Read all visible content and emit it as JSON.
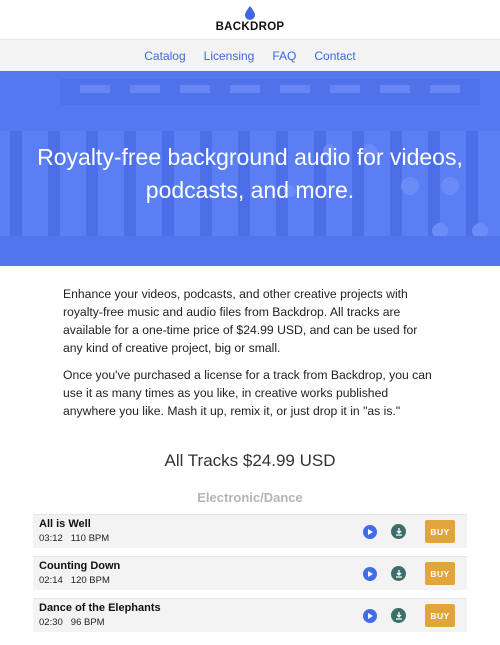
{
  "brand": {
    "logo_text": "BACKDROP"
  },
  "nav": {
    "items": [
      "Catalog",
      "Licensing",
      "FAQ",
      "Contact"
    ]
  },
  "hero": {
    "title": "Royalty-free background audio for videos, podcasts, and more."
  },
  "intro": {
    "paragraphs": [
      "Enhance your videos, podcasts, and other creative projects with royalty-free music and audio files from Backdrop. All tracks are available for a one-time price of $24.99 USD, and can be used for any kind of creative project, big or small.",
      "Once you've purchased a license for a track from Backdrop, you can use it as many times as you like, in creative works published anywhere you like. Mash it up, remix it, or just drop it in \"as is.\""
    ]
  },
  "catalog": {
    "heading": "All Tracks $24.99 USD",
    "category": "Electronic/Dance",
    "buy_label": "BUY",
    "tracks": [
      {
        "title": "All is Well",
        "duration": "03:12",
        "bpm": "110 BPM"
      },
      {
        "title": "Counting Down",
        "duration": "02:14",
        "bpm": "120 BPM"
      },
      {
        "title": "Dance of the Elephants",
        "duration": "02:30",
        "bpm": "96 BPM"
      }
    ]
  },
  "colors": {
    "accent": "#3e67e6",
    "hero": "#5a7ef3",
    "buy": "#e2a43c",
    "download": "#3c6e6a"
  },
  "icons": {
    "play": "play-icon",
    "download": "download-icon",
    "logo": "water-drop-icon"
  }
}
